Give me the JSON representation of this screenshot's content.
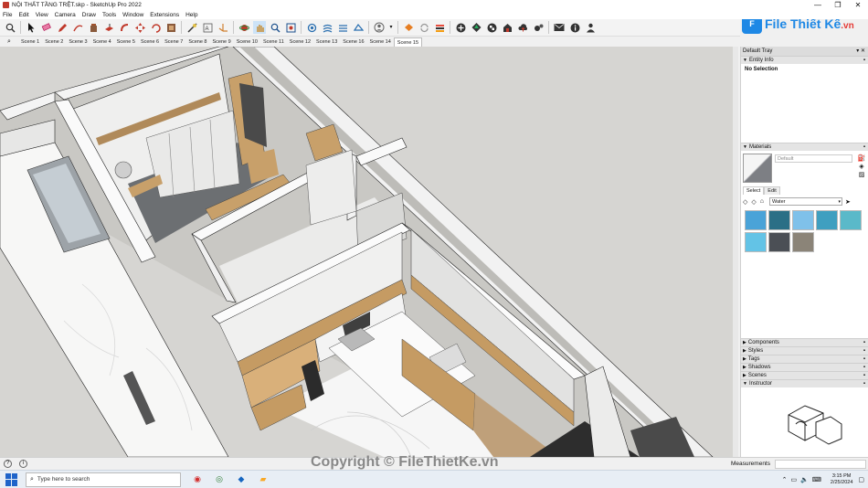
{
  "window": {
    "title": "NỘI THẤT TẦNG TRỆT.skp - SketchUp Pro 2022",
    "controls": [
      "—",
      "❐",
      "✕"
    ]
  },
  "menu": [
    "File",
    "Edit",
    "View",
    "Camera",
    "Draw",
    "Tools",
    "Window",
    "Extensions",
    "Help"
  ],
  "toolbar": {
    "icons": [
      "search-icon",
      "select-arrow-icon",
      "eraser-icon",
      "pencil-icon",
      "shape-icon",
      "paint-bucket-icon",
      "push-pull-icon",
      "follow-me-icon",
      "move-icon",
      "rotate-icon",
      "scale-icon",
      "offset-icon",
      "tape-measure-icon",
      "text-icon",
      "axes-icon",
      "orbit-icon",
      "pan-icon",
      "zoom-icon",
      "zoom-extents-icon",
      "section-icon",
      "user-icon",
      "sync-icon",
      "layer-icon",
      "dot-icon",
      "tree-icon",
      "grid-icon",
      "warehouse-icon",
      "upload-icon",
      "settings-icon",
      "mail-icon",
      "info-icon",
      "person-icon"
    ]
  },
  "scenes": {
    "tabs": [
      "Scene 1",
      "Scene 2",
      "Scene 3",
      "Scene 4",
      "Scene 5",
      "Scene 6",
      "Scene 7",
      "Scene 8",
      "Scene 9",
      "Scene 10",
      "Scene 11",
      "Scene 12",
      "Scene 13",
      "Scene 16",
      "Scene 14",
      "Scene 15"
    ],
    "active": "Scene 15"
  },
  "tray": {
    "title": "Default Tray",
    "entity_info": {
      "header": "Entity Info",
      "value": "No Selection"
    },
    "materials": {
      "header": "Materials",
      "material_name": "Default",
      "tab_select": "Select",
      "tab_edit": "Edit",
      "library": "Water",
      "swatches": [
        "#4aa3d8",
        "#2b6f86",
        "#7fc1ea",
        "#3f9fc0",
        "#5ab9c9",
        "#63c3e6",
        "#4b4f55",
        "#8b8478"
      ]
    },
    "panels": [
      "Components",
      "Styles",
      "Tags",
      "Shadows",
      "Scenes",
      "Instructor"
    ]
  },
  "status": {
    "measurements_label": "Measurements"
  },
  "taskbar": {
    "search_placeholder": "Type here to search",
    "time": "3:15 PM",
    "date": "2/25/2024"
  },
  "brand": {
    "logo_text": "File Thiết Kế",
    "logo_suffix": ".vn"
  },
  "watermark": "Copyright © FileThietKe.vn"
}
